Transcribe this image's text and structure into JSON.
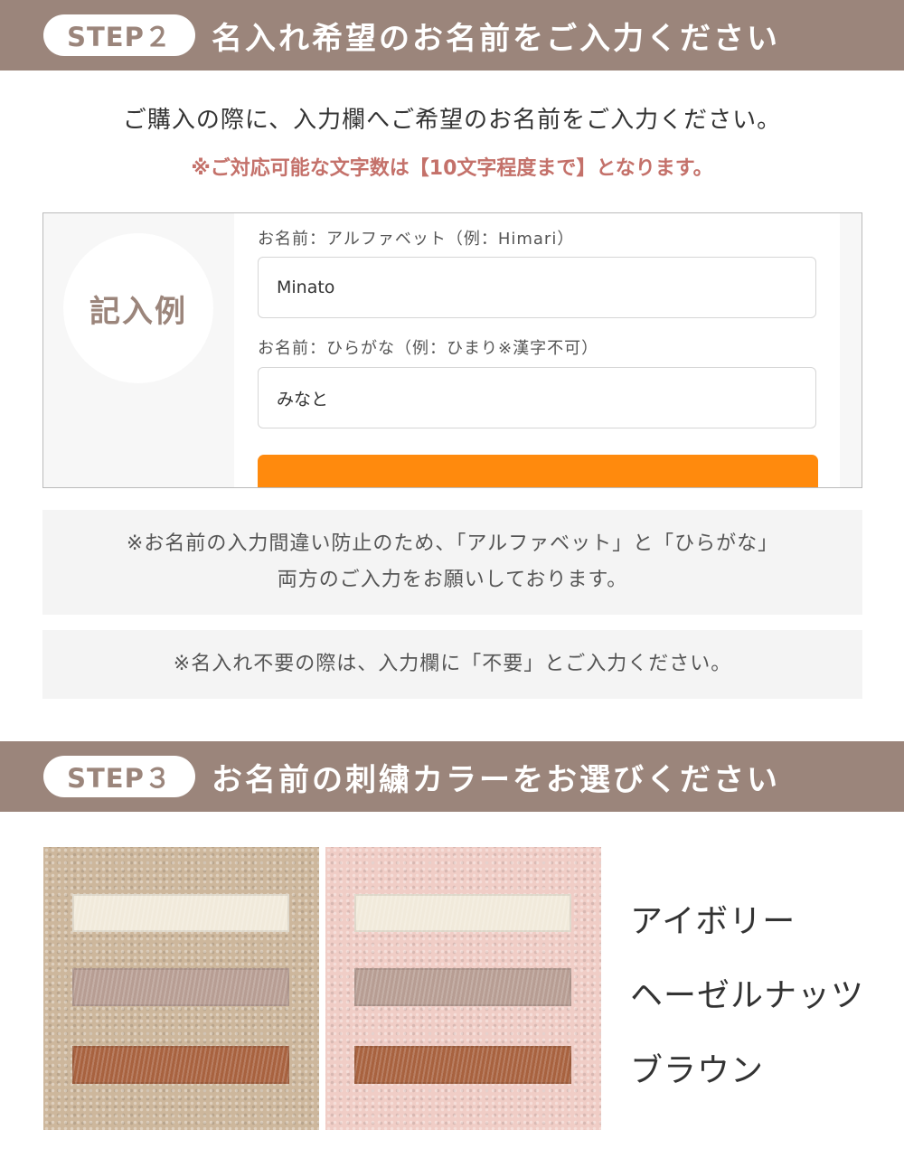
{
  "step2": {
    "badge": "STEP２",
    "title": "名入れ希望のお名前をご入力ください"
  },
  "intro": {
    "text": "ご購入の際に、入力欄へご希望のお名前をご入力ください。",
    "note": "※ご対応可能な文字数は【10文字程度まで】となります。"
  },
  "example": {
    "badge": "記入例",
    "field1_label": "お名前：アルファベット（例：Himari）",
    "field1_value": "Minato",
    "field2_label": "お名前：ひらがな（例：ひまり※漢字不可）",
    "field2_value": "みなと"
  },
  "notes": {
    "note1_line1": "※お名前の入力間違い防止のため、「アルファベット」と「ひらがな」",
    "note1_line2": "両方のご入力をお願いしております。",
    "note2": "※名入れ不要の際は、入力欄に「不要」とご入力ください。"
  },
  "step3": {
    "badge": "STEP３",
    "title": "お名前の刺繍カラーをお選びください"
  },
  "colors": {
    "items": [
      "アイボリー",
      "ヘーゼルナッツ",
      "ブラウン"
    ],
    "swatch_hex": [
      "#f1eadb",
      "#b79d93",
      "#a8623f"
    ],
    "towel_hex": [
      "#cdb79c",
      "#f0cdc6"
    ]
  },
  "theme": {
    "band": "#9b857b",
    "accent_red": "#c4716a",
    "button": "#ff8a0d"
  }
}
